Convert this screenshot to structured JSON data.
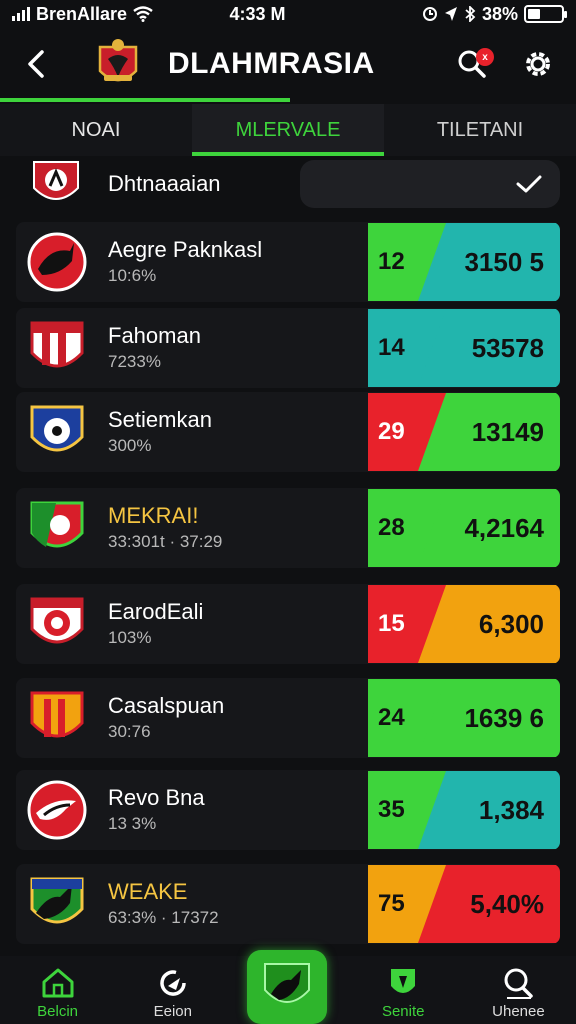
{
  "status": {
    "carrier": "BrenAllare",
    "time": "4:33 M",
    "battery_text": "38%",
    "battery_level": 0.38
  },
  "header": {
    "title": "DLAHMRASIA",
    "notification_count": "x"
  },
  "tabs": [
    {
      "label": "NOAI"
    },
    {
      "label": "MLERVALE"
    },
    {
      "label": "TILETANI"
    }
  ],
  "filter": {
    "label": "Dhtnaaaian"
  },
  "colors": {
    "green": "#3ed43c",
    "teal": "#22b5ad",
    "red": "#e8222b",
    "orange": "#f2a20f",
    "gold": "#f5c542"
  },
  "teams": [
    {
      "name": "Aegre Paknkasl",
      "sub": "10:6%",
      "stat_a": "12",
      "stat_b": "3150 5",
      "left_color": "#3ed43c",
      "right_color": "#22b5ad",
      "logo": "red-circle-crest-icon"
    },
    {
      "name": "Fahoman",
      "sub": "7233%",
      "stat_a": "14",
      "stat_b": "53578",
      "left_color": "#22b5ad",
      "right_color": "#22b5ad",
      "logo": "red-striped-shield-icon"
    },
    {
      "name": "Setiemkan",
      "sub": "300%",
      "stat_a": "29",
      "stat_b": "13149",
      "left_color": "#e8222b",
      "right_color": "#3ed43c",
      "logo": "blue-ball-shield-icon"
    },
    {
      "name": "MEKRAI!",
      "sub": "33:301t · 37:29",
      "stat_a": "28",
      "stat_b": "4,2164",
      "left_color": "#3ed43c",
      "right_color": "#3ed43c",
      "logo": "green-red-shield-icon",
      "gold": true
    },
    {
      "name": "EarodEali",
      "sub": "103%",
      "stat_a": "15",
      "stat_b": "6,300",
      "left_color": "#e8222b",
      "right_color": "#f2a20f",
      "logo": "red-ball-shield-icon"
    },
    {
      "name": "Casalspuan",
      "sub": "30:76",
      "stat_a": "24",
      "stat_b": "1639 6",
      "left_color": "#3ed43c",
      "right_color": "#3ed43c",
      "logo": "orange-striped-shield-icon"
    },
    {
      "name": "Revo Bna",
      "sub": "13 3%",
      "stat_a": "35",
      "stat_b": "1,384",
      "left_color": "#3ed43c",
      "right_color": "#22b5ad",
      "logo": "red-bird-circle-icon"
    },
    {
      "name": "WEAKE",
      "sub": "63:3% · 17372",
      "stat_a": "75",
      "stat_b": "5,40%",
      "left_color": "#f2a20f",
      "right_color": "#e8222b",
      "logo": "green-wolf-shield-icon",
      "gold": true
    }
  ],
  "nav": [
    {
      "label": "Belcin"
    },
    {
      "label": "Eeion"
    },
    {
      "label": ""
    },
    {
      "label": "Senite"
    },
    {
      "label": "Uhenee"
    }
  ]
}
